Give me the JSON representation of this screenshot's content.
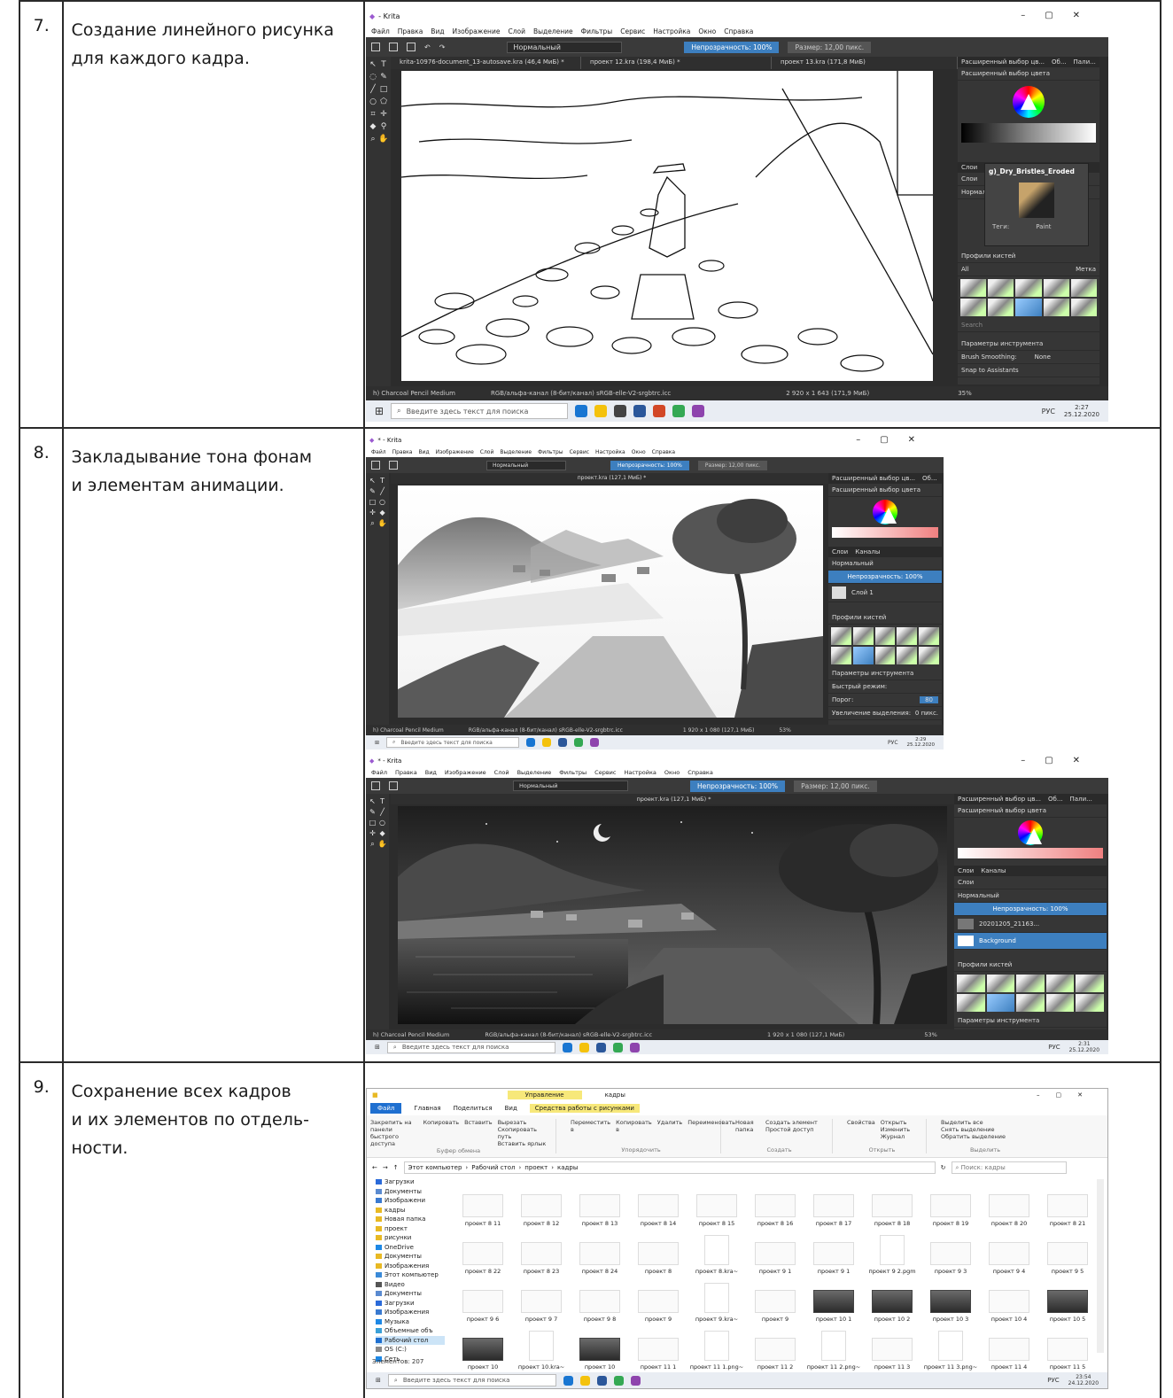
{
  "rows": [
    {
      "num": "7.",
      "lines": [
        "Создание линейного рисунка",
        "для каждого кадра."
      ]
    },
    {
      "num": "8.",
      "lines": [
        "Закладывание тона фонам",
        "и элементам анимации."
      ]
    },
    {
      "num": "9.",
      "lines": [
        "Сохранение всех кадров",
        "и их элементов по отдель-",
        "ности."
      ]
    }
  ],
  "krita": {
    "title1": "- Krita",
    "title2": "* - Krita",
    "menu": [
      "Файл",
      "Правка",
      "Вид",
      "Изображение",
      "Слой",
      "Выделение",
      "Фильтры",
      "Сервис",
      "Настройка",
      "Окно",
      "Справка"
    ],
    "blend_mode": "Нормальный",
    "opacity": "Непрозрачность: 100%",
    "size": "Размер: 12,00 пикс.",
    "tabs_shot1": [
      "krita-10976-document_13-autosave.kra (46,4 МиБ) *",
      "проект 12.kra (198,4 МиБ) *",
      "проект 13.kra (171,8 МиБ)"
    ],
    "tab_shot2": "проект.kra (127,1 МиБ) *",
    "dock_tabs": [
      "Расширенный выбор цв...",
      "Об...",
      "Пали..."
    ],
    "dock_color_title": "Расширенный выбор цвета",
    "layers_tabs": [
      "Слои",
      "Каналы"
    ],
    "layers_label": "Слои",
    "layer_mode": "Нормальный",
    "layer1": "Слой 1",
    "layer_bg": "Background",
    "layer_top": "20201205_21163...",
    "brush_preset": "g)_Dry_Bristles_Eroded",
    "brush_tags": "Теги:",
    "brush_tag_value": "Paint",
    "brush_profiles": "Профили кистей",
    "brush_filter": "All",
    "brush_tag": "Метка",
    "search": "Search",
    "tool_params": "Параметры инструмента",
    "brush_smoothing": "Brush Smoothing:",
    "smoothing_value": "None",
    "snap": "Snap to Assistants",
    "fast_mode": "Быстрый режим:",
    "threshold": "Порог:",
    "threshold_value": "80",
    "grow": "Увеличение выделения:",
    "grow_value": "0 пикс.",
    "status_brush": "h) Charcoal Pencil Medium",
    "status_color": "RGB/альфа-канал (8-бит/канал) sRGB-elle-V2-srgbtrc.icc",
    "status_size1": "2 920 x 1 643 (171,9 МиБ)",
    "status_size2": "1 920 x 1 080 (127,1 МиБ)",
    "zoom1": "35%",
    "zoom2": "53%"
  },
  "taskbar": {
    "search": "Введите здесь текст для поиска",
    "lang": "РУС",
    "times": [
      {
        "time": "2:27",
        "date": "25.12.2020"
      },
      {
        "time": "2:29",
        "date": "25.12.2020"
      },
      {
        "time": "2:31",
        "date": "25.12.2020"
      },
      {
        "time": "23:54",
        "date": "24.12.2020"
      }
    ]
  },
  "explorer": {
    "context_tab": "Управление",
    "window_title": "кадры",
    "tabs": [
      "Файл",
      "Главная",
      "Поделиться",
      "Вид",
      "Средства работы с рисунками"
    ],
    "ribbon": {
      "pin": "Закрепить на панели быстрого доступа",
      "copy": "Копировать",
      "paste": "Вставить",
      "cut": "Вырезать",
      "copy_path": "Скопировать путь",
      "paste_shortcut": "Вставить ярлык",
      "clipboard": "Буфер обмена",
      "move": "Переместить в",
      "copy_to": "Копировать в",
      "delete": "Удалить",
      "rename": "Переименовать",
      "organize": "Упорядочить",
      "new_folder": "Новая папка",
      "new_item": "Создать элемент",
      "easy_access": "Простой доступ",
      "create": "Создать",
      "properties": "Свойства",
      "open": "Открыть",
      "edit": "Изменить",
      "history": "Журнал",
      "open_group": "Открыть",
      "select_all": "Выделить все",
      "select_none": "Снять выделение",
      "invert": "Обратить выделение",
      "select_group": "Выделить"
    },
    "breadcrumb": [
      "Этот компьютер",
      "Рабочий стол",
      "проект",
      "кадры"
    ],
    "search_placeholder": "Поиск: кадры",
    "nav": [
      "Загрузки",
      "Документы",
      "Изображени",
      "кадры",
      "Новая папка",
      "проект",
      "рисунки",
      "OneDrive",
      "Документы",
      "Изображения",
      "Этот компьютер",
      "Видео",
      "Документы",
      "Загрузки",
      "Изображения",
      "Музыка",
      "Объемные объ",
      "Рабочий стол",
      "OS (C:)",
      "Сеть"
    ],
    "items": [
      {
        "name": "проект 8 11",
        "kind": "light"
      },
      {
        "name": "проект 8 12",
        "kind": "light"
      },
      {
        "name": "проект 8 13",
        "kind": "light"
      },
      {
        "name": "проект 8 14",
        "kind": "light"
      },
      {
        "name": "проект 8 15",
        "kind": "light"
      },
      {
        "name": "проект 8 16",
        "kind": "light"
      },
      {
        "name": "проект 8 17",
        "kind": "light"
      },
      {
        "name": "проект 8 18",
        "kind": "light"
      },
      {
        "name": "проект 8 19",
        "kind": "light"
      },
      {
        "name": "проект 8 20",
        "kind": "light"
      },
      {
        "name": "проект 8 21",
        "kind": "light"
      },
      {
        "name": "проект 8 22",
        "kind": "light"
      },
      {
        "name": "проект 8 23",
        "kind": "light"
      },
      {
        "name": "проект 8 24",
        "kind": "light"
      },
      {
        "name": "проект 8",
        "kind": "light"
      },
      {
        "name": "проект 8.kra~",
        "kind": "doc"
      },
      {
        "name": "проект 9 1",
        "kind": "light"
      },
      {
        "name": "проект 9 1",
        "kind": "light"
      },
      {
        "name": "проект 9 2.pgm",
        "kind": "doc"
      },
      {
        "name": "проект 9 3",
        "kind": "light"
      },
      {
        "name": "проект 9 4",
        "kind": "light"
      },
      {
        "name": "проект 9 5",
        "kind": "light"
      },
      {
        "name": "проект 9 6",
        "kind": "light"
      },
      {
        "name": "проект 9 7",
        "kind": "light"
      },
      {
        "name": "проект 9 8",
        "kind": "light"
      },
      {
        "name": "проект 9",
        "kind": "light"
      },
      {
        "name": "проект 9.kra~",
        "kind": "doc"
      },
      {
        "name": "проект 9",
        "kind": "light"
      },
      {
        "name": "проект 10 1",
        "kind": "dark"
      },
      {
        "name": "проект 10 2",
        "kind": "dark"
      },
      {
        "name": "проект 10 3",
        "kind": "dark"
      },
      {
        "name": "проект 10 4",
        "kind": "light"
      },
      {
        "name": "проект 10 5",
        "kind": "dark"
      },
      {
        "name": "проект 10",
        "kind": "dark"
      },
      {
        "name": "проект 10.kra~",
        "kind": "doc"
      },
      {
        "name": "проект 10",
        "kind": "dark"
      },
      {
        "name": "проект 11 1",
        "kind": "light"
      },
      {
        "name": "проект 11 1.png~",
        "kind": "doc"
      },
      {
        "name": "проект 11 2",
        "kind": "light"
      },
      {
        "name": "проект 11 2.png~",
        "kind": "doc"
      },
      {
        "name": "проект 11 3",
        "kind": "light"
      },
      {
        "name": "проект 11 3.png~",
        "kind": "doc"
      },
      {
        "name": "проект 11 4",
        "kind": "light"
      },
      {
        "name": "проект 11 5",
        "kind": "light"
      },
      {
        "name": "проект 11 6",
        "kind": "light"
      },
      {
        "name": "проект 11 7",
        "kind": "light"
      },
      {
        "name": "проект 11 8",
        "kind": "light"
      },
      {
        "name": "проект 11",
        "kind": "check"
      },
      {
        "name": "проект 11.kra~",
        "kind": "doc"
      },
      {
        "name": "проект 11",
        "kind": "dark"
      },
      {
        "name": "проект 12 1",
        "kind": "light"
      },
      {
        "name": "проект 12 2",
        "kind": "light"
      },
      {
        "name": "проект 12 3",
        "kind": "light"
      },
      {
        "name": "проект 12 4",
        "kind": "light"
      },
      {
        "name": "проект 12 5",
        "kind": "light"
      }
    ],
    "count": "Элементов: 207"
  }
}
